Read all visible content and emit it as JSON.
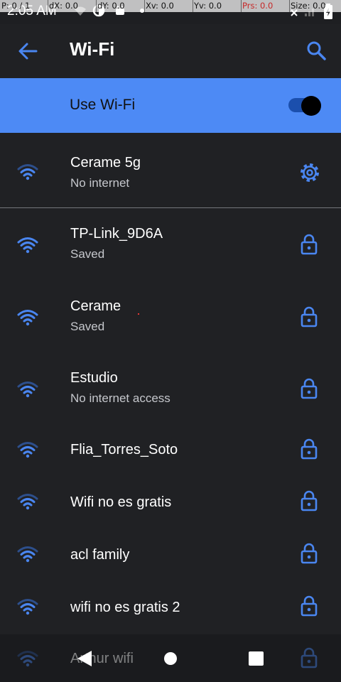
{
  "status_bar": {
    "time": "2:05 AM"
  },
  "pointer_overlay": {
    "p": "P: 0 / 1",
    "dx": "dX: 0.0",
    "dy": "dY: 0.0",
    "xv": "Xv: 0.0",
    "yv": "Yv: 0.0",
    "prs": "Prs: 0.0",
    "size": "Size: 0.0"
  },
  "toolbar": {
    "title": "Wi-Fi",
    "back_icon": "arrow-back-icon",
    "search_icon": "search-icon"
  },
  "master_switch": {
    "label": "Use Wi-Fi",
    "state": "on"
  },
  "networks": [
    {
      "name": "Cerame 5g",
      "summary": "No internet",
      "action": "settings",
      "connected": true
    },
    {
      "name": "TP-Link_9D6A",
      "summary": "Saved",
      "action": "lock"
    },
    {
      "name": "Cerame",
      "summary": "Saved",
      "action": "lock"
    },
    {
      "name": "Estudio",
      "summary": "No internet access",
      "action": "lock"
    },
    {
      "name": "Flia_Torres_Soto",
      "summary": "",
      "action": "lock"
    },
    {
      "name": "Wifi no es gratis",
      "summary": "",
      "action": "lock"
    },
    {
      "name": "acl family",
      "summary": "",
      "action": "lock"
    },
    {
      "name": "wifi no es gratis 2",
      "summary": "",
      "action": "lock"
    },
    {
      "name": "Arthur wifi",
      "summary": "",
      "action": "lock"
    }
  ],
  "colors": {
    "accent": "#4d8af5",
    "icon_blue": "#4a86f0",
    "background": "#202124"
  }
}
